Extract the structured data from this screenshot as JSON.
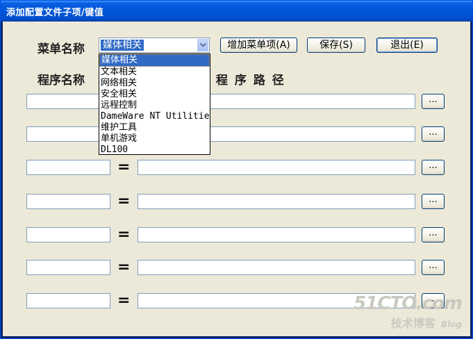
{
  "window": {
    "title": "添加配置文件子项/键值"
  },
  "menu": {
    "label": "菜单名称",
    "combo_value": "媒体相关",
    "add_button": "增加菜单项(A)",
    "save_button": "保存(S)",
    "exit_button": "退出(E)"
  },
  "headers": {
    "program_name": "程序名称",
    "program_path": "程 序 路 径"
  },
  "rows": [
    {
      "name": "",
      "path": "",
      "equals": "=",
      "browse": "..."
    },
    {
      "name": "",
      "path": "",
      "equals": "=",
      "browse": "..."
    },
    {
      "name": "",
      "path": "",
      "equals": "=",
      "browse": "..."
    },
    {
      "name": "",
      "path": "",
      "equals": "=",
      "browse": "..."
    },
    {
      "name": "",
      "path": "",
      "equals": "=",
      "browse": "..."
    },
    {
      "name": "",
      "path": "",
      "equals": "=",
      "browse": "..."
    },
    {
      "name": "",
      "path": "",
      "equals": "=",
      "browse": "..."
    }
  ],
  "dropdown": {
    "options": [
      "媒体相关",
      "文本相关",
      "网络相关",
      "安全相关",
      "远程控制",
      "DameWare NT Utilities",
      "维护工具",
      "单机游戏",
      "DL100"
    ],
    "selected_index": 0
  },
  "watermark": {
    "line1": "51CTO.com",
    "line2": "技术博客",
    "line3": "Blog"
  }
}
